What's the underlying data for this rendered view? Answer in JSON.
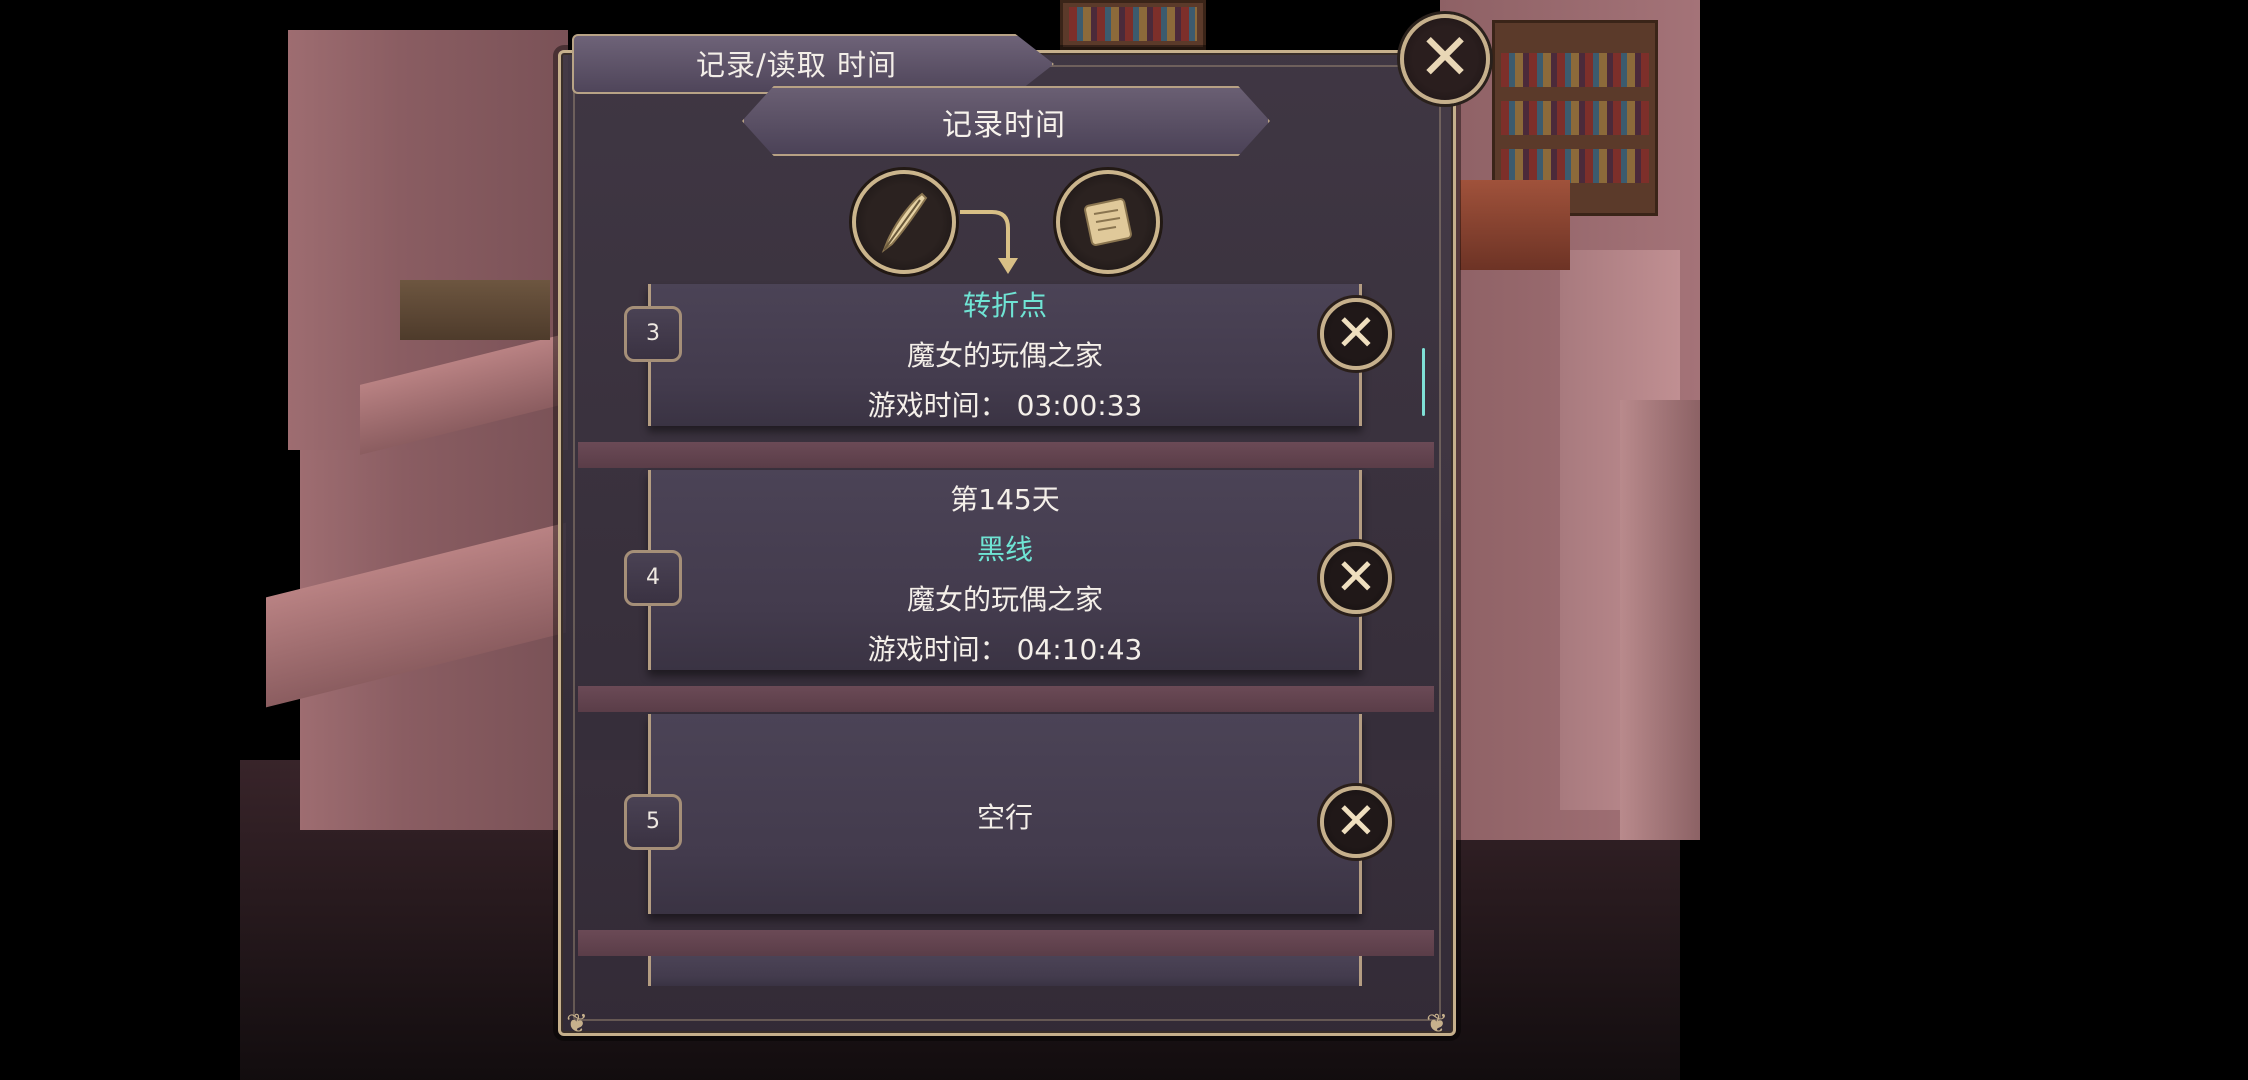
{
  "window": {
    "title": "记录/读取 时间",
    "close_glyph": "✕"
  },
  "subtitle": "记录时间",
  "icons": {
    "write": "quill-icon",
    "arrow": "curved-arrow-icon",
    "read": "scroll-icon"
  },
  "slots": [
    {
      "number": "3",
      "tag": "转折点",
      "location": "魔女的玩偶之家",
      "playtime": "游戏时间： 03:00:33",
      "delete_glyph": "✕"
    },
    {
      "number": "4",
      "day": "第145天",
      "tag": "黑线",
      "location": "魔女的玩偶之家",
      "playtime": "游戏时间： 04:10:43",
      "delete_glyph": "✕"
    },
    {
      "number": "5",
      "empty_label": "空行",
      "delete_glyph": "✕"
    }
  ],
  "colors": {
    "frame_gold": "#c6b08c",
    "highlight_teal": "#6fe4d4",
    "panel": "#433b4d"
  }
}
